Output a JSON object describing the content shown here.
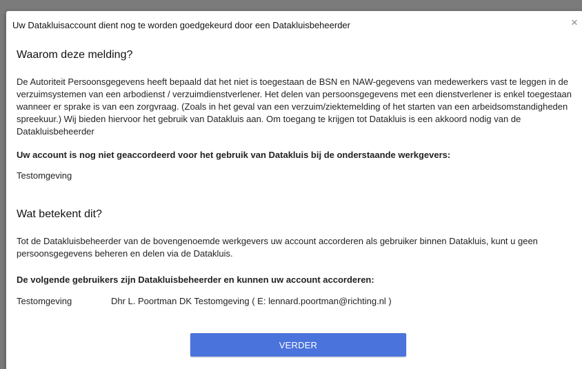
{
  "dialog": {
    "title": "Uw Datakluisaccount dient nog te worden goedgekeurd door een Datakluisbeheerder",
    "close_icon": "×"
  },
  "section1": {
    "heading": "Waarom deze melding?",
    "paragraph": "De Autoriteit Persoonsgegevens heeft bepaald dat het niet is toegestaan de BSN en NAW-gegevens van medewerkers vast te leggen in de verzuimsystemen van een arbodienst / verzuimdienstverlener. Het delen van persoonsgegevens met een dienstverlener is enkel toegestaan wanneer er sprake is van een zorgvraag. (Zoals in het geval van een verzuim/ziektemelding of het starten van een arbeidsomstandigheden spreekuur.) Wij bieden hiervoor het gebruik van Datakluis aan. Om toegang te krijgen tot Datakluis is een akkoord nodig van de Datakluisbeheerder",
    "employers_label": "Uw account is nog niet geaccordeerd voor het gebruik van Datakluis bij de onderstaande werkgevers:",
    "employers": [
      "Testomgeving"
    ]
  },
  "section2": {
    "heading": "Wat betekent dit?",
    "paragraph": "Tot de Datakluisbeheerder van de bovengenoemde werkgevers uw account accorderen als gebruiker binnen Datakluis, kunt u geen persoonsgegevens beheren en delen via de Datakluis.",
    "admins_label": "De volgende gebruikers zijn Datakluisbeheerder en kunnen uw account accorderen:",
    "admins": [
      {
        "environment": "Testomgeving",
        "admin": "Dhr L. Poortman DK Testomgeving ( E: lennard.poortman@richting.nl )"
      }
    ]
  },
  "actions": {
    "continue_label": "VERDER",
    "button_color": "#4a73dc"
  }
}
